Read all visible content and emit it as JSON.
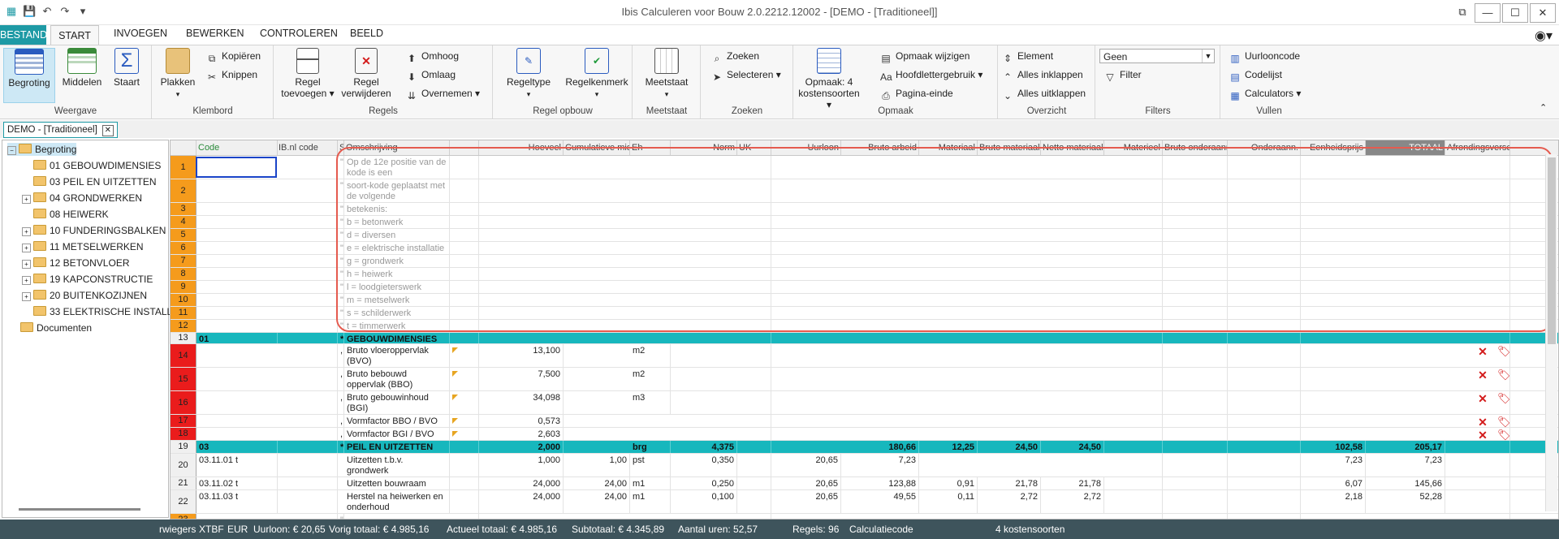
{
  "window": {
    "title": "Ibis Calculeren voor Bouw 2.0.2212.12002 - [DEMO - [Traditioneel]]",
    "buttons": [
      "⧉",
      "—",
      "☐",
      "✕"
    ]
  },
  "qat": [
    "▦",
    "💾",
    "↶",
    "↷",
    "▾"
  ],
  "tabs": [
    "BESTAND",
    "START",
    "INVOEGEN",
    "BEWERKEN",
    "CONTROLEREN",
    "BEELD"
  ],
  "ribbon": {
    "weergave": {
      "label": "Weergave",
      "begroting": "Begroting",
      "middelen": "Middelen",
      "staart": "Staart"
    },
    "klembord": {
      "label": "Klembord",
      "plakken": "Plakken",
      "kopieren": "Kopiëren",
      "knippen": "Knippen"
    },
    "regels": {
      "label": "Regels",
      "toevoegen": "Regel toevoegen ▾",
      "verwijderen": "Regel verwijderen",
      "omhoog": "Omhoog",
      "omlaag": "Omlaag",
      "overnemen": "Overnemen"
    },
    "regelopbouw": {
      "label": "Regel opbouw",
      "regeltype": "Regeltype",
      "regelkenmerk": "Regelkenmerk"
    },
    "meetstaat": {
      "label": "Meetstaat",
      "meetstaat": "Meetstaat"
    },
    "zoeken": {
      "label": "Zoeken",
      "zoeken": "Zoeken",
      "selecteren": "Selecteren"
    },
    "opmaak": {
      "label": "Opmaak",
      "opmaak4": "Opmaak: 4 kostensoorten ▾",
      "wijzigen": "Opmaak wijzigen",
      "hoofdletter": "Hoofdlettergebruik",
      "paginaeinde": "Pagina-einde"
    },
    "overzicht": {
      "label": "Overzicht",
      "element": "Element",
      "inklappen": "Alles inklappen",
      "uitklappen": "Alles uitklappen"
    },
    "filters": {
      "label": "Filters",
      "dropdown": "Geen",
      "filter": "Filter"
    },
    "vullen": {
      "label": "Vullen",
      "uurlooncode": "Uurlooncode",
      "codelijst": "Codelijst",
      "calculators": "Calculators"
    }
  },
  "doc_tab": "DEMO - [Traditioneel]",
  "tree": [
    {
      "label": "Begroting",
      "level": 0,
      "sel": true,
      "toggle": "−"
    },
    {
      "label": "01 GEBOUWDIMENSIES",
      "level": 1,
      "toggle": ""
    },
    {
      "label": "03 PEIL EN UITZETTEN",
      "level": 1,
      "toggle": ""
    },
    {
      "label": "04 GRONDWERKEN",
      "level": 1,
      "toggle": "+"
    },
    {
      "label": "08 HEIWERK",
      "level": 1,
      "toggle": ""
    },
    {
      "label": "10 FUNDERINGSBALKEN",
      "level": 1,
      "toggle": "+"
    },
    {
      "label": "11 METSELWERKEN",
      "level": 1,
      "toggle": "+"
    },
    {
      "label": "12 BETONVLOER",
      "level": 1,
      "toggle": "+"
    },
    {
      "label": "19 KAPCONSTRUCTIE",
      "level": 1,
      "toggle": "+"
    },
    {
      "label": "20 BUITENKOZIJNEN",
      "level": 1,
      "toggle": "+"
    },
    {
      "label": "33 ELEKTRISCHE INSTALL",
      "level": 1,
      "toggle": ""
    },
    {
      "label": "Documenten",
      "level": 0,
      "toggle": ""
    }
  ],
  "columns": [
    "Code",
    "IB.nl code",
    "S",
    "Omschrijving",
    "",
    "Hoeveel",
    "Cumulatieve middel",
    "Eh",
    "Norm",
    "UK",
    "Uurloon",
    "Bruto arbeid",
    "Materiaal",
    "Bruto materiaal",
    "Netto materiaal",
    "Materieel",
    "Bruto onderaanneem",
    "Onderaann.",
    "Eenheidsprijs",
    "TOTAAL",
    "Afrondingsverschil"
  ],
  "rows": [
    {
      "n": "1",
      "s": "\"",
      "desc": "Op de 12e positie van de kode is een"
    },
    {
      "n": "2",
      "s": "\"",
      "desc": "soort-kode geplaatst met de volgende"
    },
    {
      "n": "3",
      "s": "\"",
      "desc": "betekenis:"
    },
    {
      "n": "4",
      "s": "\"",
      "desc": "b = betonwerk"
    },
    {
      "n": "5",
      "s": "\"",
      "desc": "d = diversen"
    },
    {
      "n": "6",
      "s": "\"",
      "desc": "e = elektrische installatie"
    },
    {
      "n": "7",
      "s": "\"",
      "desc": "g = grondwerk"
    },
    {
      "n": "8",
      "s": "\"",
      "desc": "h = heiwerk"
    },
    {
      "n": "9",
      "s": "\"",
      "desc": "l = loodgieterswerk"
    },
    {
      "n": "10",
      "s": "\"",
      "desc": "m = metselwerk"
    },
    {
      "n": "11",
      "s": "\"",
      "desc": "s = schilderwerk"
    },
    {
      "n": "12",
      "s": "\"",
      "desc": "t = timmerwerk"
    },
    {
      "n": "13",
      "code": "01",
      "s": "*",
      "desc": "GEBOUWDIMENSIES"
    },
    {
      "n": "14",
      "s": ",",
      "desc": "Bruto vloeroppervlak (BVO)",
      "qty": "13,100",
      "eh": "m2"
    },
    {
      "n": "15",
      "s": ",",
      "desc": "Bruto bebouwd oppervlak (BBO)",
      "qty": "7,500",
      "eh": "m2"
    },
    {
      "n": "16",
      "s": ",",
      "desc": "Bruto gebouwinhoud (BGI)",
      "qty": "34,098",
      "eh": "m3"
    },
    {
      "n": "17",
      "s": ",",
      "desc": "Vormfactor BBO / BVO",
      "qty": "0,573"
    },
    {
      "n": "18",
      "s": ",",
      "desc": "Vormfactor BGI / BVO",
      "qty": "2,603"
    },
    {
      "n": "19",
      "code": "03",
      "s": "*",
      "desc": "PEIL EN UITZETTEN",
      "qty": "2,000",
      "eh": "brg",
      "norm": "4,375",
      "ba": "180,66",
      "mat": "12,25",
      "bm": "24,50",
      "nm": "24,50",
      "ep": "102,58",
      "tot": "205,17"
    },
    {
      "n": "20",
      "code": "03.11.01    t",
      "desc": "Uitzetten t.b.v. grondwerk",
      "qty": "1,000",
      "cum": "1,00",
      "eh": "pst",
      "norm": "0,350",
      "ul": "20,65",
      "ba": "7,23",
      "ep": "7,23",
      "tot": "7,23"
    },
    {
      "n": "21",
      "code": "03.11.02    t",
      "desc": "Uitzetten bouwraam",
      "qty": "24,000",
      "cum": "24,00",
      "eh": "m1",
      "norm": "0,250",
      "ul": "20,65",
      "ba": "123,88",
      "mat": "0,91",
      "bm": "21,78",
      "nm": "21,78",
      "ep": "6,07",
      "tot": "145,66"
    },
    {
      "n": "22",
      "code": "03.11.03    t",
      "desc": "Herstel na heiwerken en onderhoud",
      "qty": "24,000",
      "cum": "24,00",
      "eh": "m1",
      "norm": "0,100",
      "ul": "20,65",
      "ba": "49,55",
      "mat": "0,11",
      "bm": "2,72",
      "nm": "2,72",
      "ep": "2,18",
      "tot": "52,28"
    },
    {
      "n": "23",
      "s": "\""
    }
  ],
  "status": {
    "user": "rwiegers",
    "fmt": "XTBF",
    "cur": "EUR",
    "uurloon": "Uurloon: € 20,65",
    "vorig": "Vorig totaal: € 4.985,16",
    "actueel": "Actueel totaal: € 4.985,16",
    "subtotaal": "Subtotaal: € 4.345,89",
    "uren": "Aantal uren: 52,57",
    "regels": "Regels: 96",
    "calc": "Calculatiecode",
    "kosten": "4 kostensoorten"
  }
}
